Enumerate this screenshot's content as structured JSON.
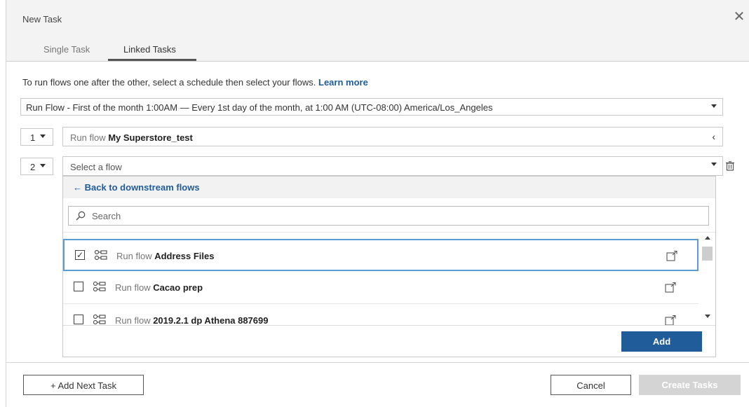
{
  "dialog": {
    "title": "New Task",
    "close_glyph": "✕"
  },
  "tabs": [
    {
      "label": "Single Task",
      "active": false
    },
    {
      "label": "Linked Tasks",
      "active": true
    }
  ],
  "intro": {
    "text": "To run flows one after the other, select a schedule then select your flows. ",
    "link": "Learn more"
  },
  "schedule": {
    "value": "Run Flow - First of the month 1:00AM — Every 1st day of the month, at 1:00 AM (UTC-08:00) America/Los_Angeles"
  },
  "steps": [
    {
      "number": "1",
      "prefix": "Run flow",
      "name": "My Superstore_test"
    },
    {
      "number": "2",
      "placeholder": "Select a flow"
    }
  ],
  "dropdown": {
    "back_label": "← Back to downstream flows",
    "search_placeholder": "Search",
    "items": [
      {
        "prefix": "Run flow",
        "name": "Address Files",
        "checked": true
      },
      {
        "prefix": "Run flow",
        "name": "Cacao prep",
        "checked": false
      },
      {
        "prefix": "Run flow",
        "name": "2019.2.1 dp Athena 887699",
        "checked": false
      }
    ],
    "add_label": "Add"
  },
  "footer": {
    "add_next_label": "+ Add Next Task",
    "cancel_label": "Cancel",
    "create_label": "Create Tasks"
  },
  "colors": {
    "accent": "#1f5c99",
    "selected_border": "#5b9bd5",
    "disabled_button": "#d4d4d4"
  },
  "icons": {
    "close": "close-icon",
    "flow": "flow-icon",
    "external": "open-external-icon",
    "trash": "trash-icon",
    "search": "search-icon"
  }
}
